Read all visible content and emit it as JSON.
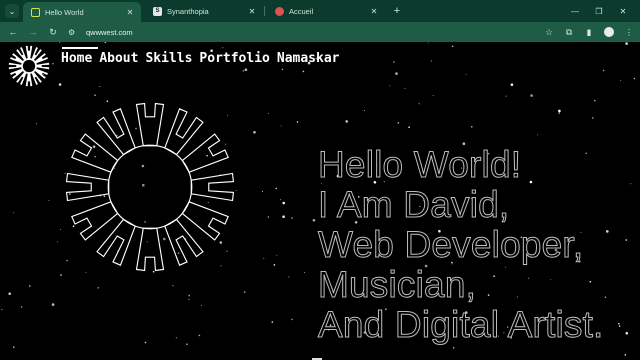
{
  "browser": {
    "tabs": [
      {
        "title": "Hello World",
        "active": true
      },
      {
        "title": "Synanthopia",
        "active": false
      },
      {
        "title": "Accueil",
        "active": false
      }
    ],
    "url": "qwwwest.com"
  },
  "nav": {
    "items": [
      "Home",
      "About",
      "Skills",
      "Portfolio",
      "Namaskar"
    ]
  },
  "hero": {
    "lines": [
      "Hello World!",
      "I Am David,",
      "Web Developer,",
      "Musician,",
      "And Digital Artist."
    ]
  },
  "colors": {
    "chrome_dark": "#0b3b2c",
    "chrome_light": "#1e5c46",
    "page_bg": "#000000",
    "hero_stroke": "#bdbdbd"
  }
}
